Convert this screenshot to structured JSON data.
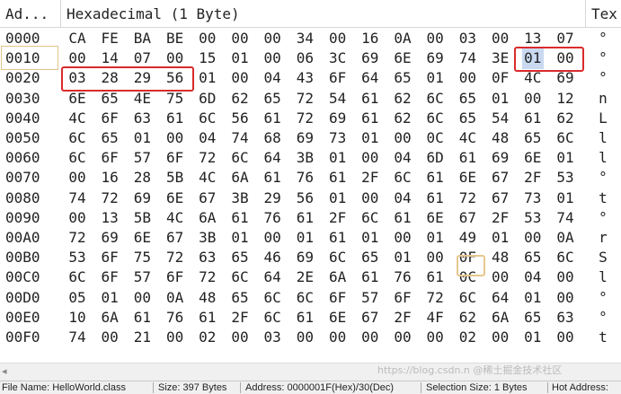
{
  "header": {
    "address_label": "Ad...",
    "hex_label": "Hexadecimal (1 Byte)",
    "text_label": "Tex"
  },
  "rows": [
    {
      "addr": "0000",
      "bytes": [
        "CA",
        "FE",
        "BA",
        "BE",
        "00",
        "00",
        "00",
        "34",
        "00",
        "16",
        "0A",
        "00",
        "03",
        "00",
        "13",
        "07"
      ],
      "text": "°"
    },
    {
      "addr": "0010",
      "bytes": [
        "00",
        "14",
        "07",
        "00",
        "15",
        "01",
        "00",
        "06",
        "3C",
        "69",
        "6E",
        "69",
        "74",
        "3E",
        "01",
        "00"
      ],
      "text": "°"
    },
    {
      "addr": "0020",
      "bytes": [
        "03",
        "28",
        "29",
        "56",
        "01",
        "00",
        "04",
        "43",
        "6F",
        "64",
        "65",
        "01",
        "00",
        "0F",
        "4C",
        "69"
      ],
      "text": "°"
    },
    {
      "addr": "0030",
      "bytes": [
        "6E",
        "65",
        "4E",
        "75",
        "6D",
        "62",
        "65",
        "72",
        "54",
        "61",
        "62",
        "6C",
        "65",
        "01",
        "00",
        "12"
      ],
      "text": "n"
    },
    {
      "addr": "0040",
      "bytes": [
        "4C",
        "6F",
        "63",
        "61",
        "6C",
        "56",
        "61",
        "72",
        "69",
        "61",
        "62",
        "6C",
        "65",
        "54",
        "61",
        "62"
      ],
      "text": "L"
    },
    {
      "addr": "0050",
      "bytes": [
        "6C",
        "65",
        "01",
        "00",
        "04",
        "74",
        "68",
        "69",
        "73",
        "01",
        "00",
        "0C",
        "4C",
        "48",
        "65",
        "6C"
      ],
      "text": "l"
    },
    {
      "addr": "0060",
      "bytes": [
        "6C",
        "6F",
        "57",
        "6F",
        "72",
        "6C",
        "64",
        "3B",
        "01",
        "00",
        "04",
        "6D",
        "61",
        "69",
        "6E",
        "01"
      ],
      "text": "l"
    },
    {
      "addr": "0070",
      "bytes": [
        "00",
        "16",
        "28",
        "5B",
        "4C",
        "6A",
        "61",
        "76",
        "61",
        "2F",
        "6C",
        "61",
        "6E",
        "67",
        "2F",
        "53"
      ],
      "text": "°"
    },
    {
      "addr": "0080",
      "bytes": [
        "74",
        "72",
        "69",
        "6E",
        "67",
        "3B",
        "29",
        "56",
        "01",
        "00",
        "04",
        "61",
        "72",
        "67",
        "73",
        "01"
      ],
      "text": "t"
    },
    {
      "addr": "0090",
      "bytes": [
        "00",
        "13",
        "5B",
        "4C",
        "6A",
        "61",
        "76",
        "61",
        "2F",
        "6C",
        "61",
        "6E",
        "67",
        "2F",
        "53",
        "74"
      ],
      "text": "°"
    },
    {
      "addr": "00A0",
      "bytes": [
        "72",
        "69",
        "6E",
        "67",
        "3B",
        "01",
        "00",
        "01",
        "61",
        "01",
        "00",
        "01",
        "49",
        "01",
        "00",
        "0A"
      ],
      "text": "r"
    },
    {
      "addr": "00B0",
      "bytes": [
        "53",
        "6F",
        "75",
        "72",
        "63",
        "65",
        "46",
        "69",
        "6C",
        "65",
        "01",
        "00",
        "0F",
        "48",
        "65",
        "6C"
      ],
      "text": "S"
    },
    {
      "addr": "00C0",
      "bytes": [
        "6C",
        "6F",
        "57",
        "6F",
        "72",
        "6C",
        "64",
        "2E",
        "6A",
        "61",
        "76",
        "61",
        "0C",
        "00",
        "04",
        "00"
      ],
      "text": "l"
    },
    {
      "addr": "00D0",
      "bytes": [
        "05",
        "01",
        "00",
        "0A",
        "48",
        "65",
        "6C",
        "6C",
        "6F",
        "57",
        "6F",
        "72",
        "6C",
        "64",
        "01",
        "00"
      ],
      "text": "°"
    },
    {
      "addr": "00E0",
      "bytes": [
        "10",
        "6A",
        "61",
        "76",
        "61",
        "2F",
        "6C",
        "61",
        "6E",
        "67",
        "2F",
        "4F",
        "62",
        "6A",
        "65",
        "63"
      ],
      "text": "°"
    },
    {
      "addr": "00F0",
      "bytes": [
        "74",
        "00",
        "21",
        "00",
        "02",
        "00",
        "03",
        "00",
        "00",
        "00",
        "00",
        "00",
        "02",
        "00",
        "01",
        "00"
      ],
      "text": "t"
    }
  ],
  "status": {
    "file_name": "File Name: HelloWorld.class",
    "size": "Size: 397 Bytes",
    "address": "Address: 0000001F(Hex)/30(Dec)",
    "selection": "Selection Size: 1 Bytes",
    "hot_address": "Hot Address:"
  },
  "watermark": "https://blog.csdn.n  @稀土掘金技术社区"
}
